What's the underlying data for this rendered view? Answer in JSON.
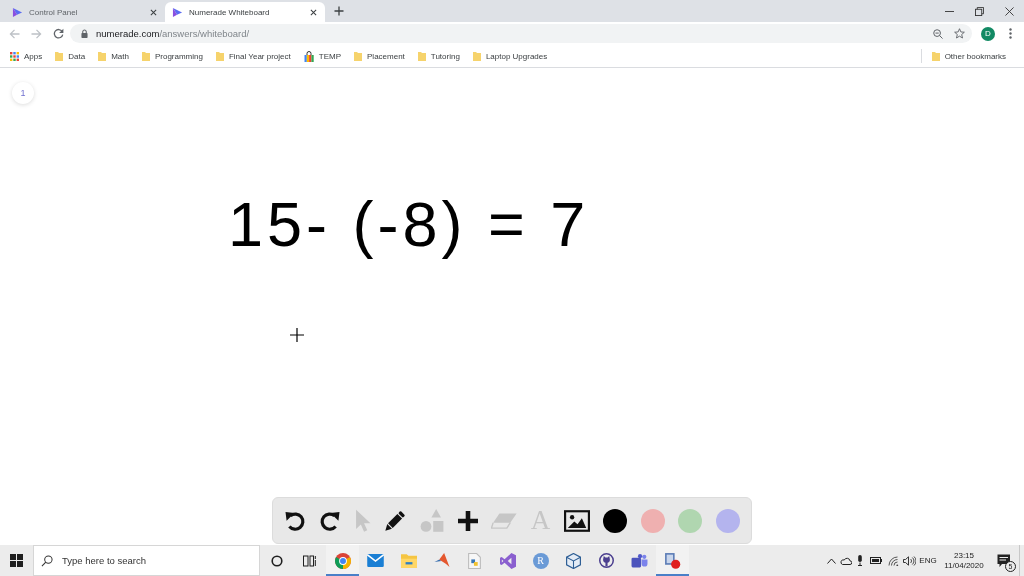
{
  "tabs": [
    {
      "title": "Control Panel",
      "selected": false
    },
    {
      "title": "Numerade Whiteboard",
      "selected": true
    }
  ],
  "navigation": {
    "back": {
      "disabled": true
    },
    "forward": {
      "disabled": true
    }
  },
  "address_bar": {
    "host": "numerade.com",
    "path": "/answers/whiteboard/"
  },
  "profile": {
    "initial": "D"
  },
  "bookmarks": [
    {
      "kind": "apps",
      "label": "Apps"
    },
    {
      "kind": "folder",
      "label": "Data"
    },
    {
      "kind": "folder",
      "label": "Math"
    },
    {
      "kind": "folder",
      "label": "Programming"
    },
    {
      "kind": "folder",
      "label": "Final Year project"
    },
    {
      "kind": "bag",
      "label": "TEMP"
    },
    {
      "kind": "folder",
      "label": "Placement"
    },
    {
      "kind": "folder",
      "label": "Tutoring"
    },
    {
      "kind": "folder",
      "label": "Laptop Upgrades"
    }
  ],
  "other_bookmarks": {
    "label": "Other bookmarks"
  },
  "whiteboard": {
    "page_number": "1",
    "handwriting": "15- (-8) = 7"
  },
  "drawing_toolbar": {
    "tools": [
      {
        "kind": "undo",
        "disabled": false
      },
      {
        "kind": "redo",
        "disabled": false
      },
      {
        "kind": "pointer",
        "disabled": true
      },
      {
        "kind": "pencil",
        "disabled": false
      },
      {
        "kind": "shapes",
        "disabled": true
      },
      {
        "kind": "plus",
        "disabled": false
      },
      {
        "kind": "eraser",
        "disabled": true
      },
      {
        "kind": "text",
        "disabled": true,
        "glyph": "A"
      },
      {
        "kind": "image",
        "disabled": false
      }
    ],
    "colors": [
      {
        "color": "#000000"
      },
      {
        "color": "#efb0b0"
      },
      {
        "color": "#b0d6b0"
      },
      {
        "color": "#b4b4ee"
      }
    ]
  },
  "taskbar": {
    "search": {
      "placeholder": "Type here to search"
    },
    "apps": [
      {
        "kind": "browser",
        "open": true
      },
      {
        "kind": "mail",
        "open": false
      },
      {
        "kind": "files",
        "open": false
      },
      {
        "kind": "peak",
        "open": false
      },
      {
        "kind": "script",
        "open": false
      },
      {
        "kind": "ribbon",
        "open": false
      },
      {
        "kind": "r-logo",
        "open": false,
        "glyph": "R"
      },
      {
        "kind": "cube",
        "open": false
      },
      {
        "kind": "cat",
        "open": false
      },
      {
        "kind": "team",
        "open": false
      },
      {
        "kind": "recorder",
        "open": true
      }
    ],
    "language": "ENG",
    "time": "23:15",
    "date": "11/04/2020",
    "notification_count": "5"
  }
}
